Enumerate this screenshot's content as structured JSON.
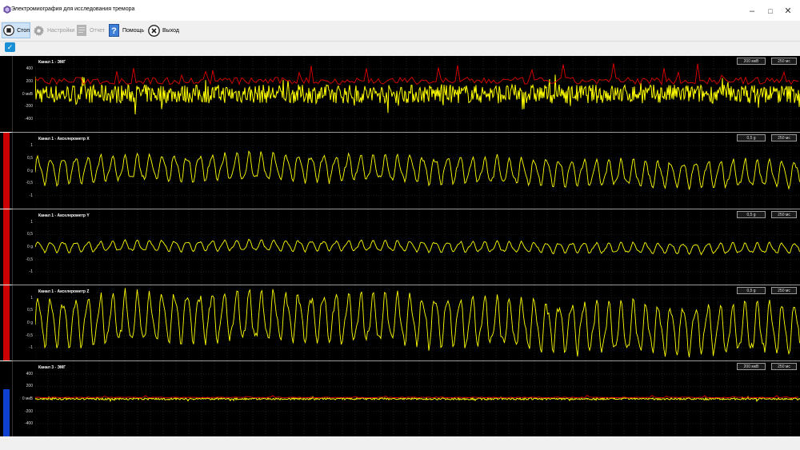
{
  "window": {
    "title": "Электромиография для исследования тремора",
    "controls": [
      "–",
      "□",
      "✕"
    ]
  },
  "toolbar": {
    "stop_label": "Стоп",
    "settings_label": "Настройки",
    "report_label": "Отчет",
    "help_label": "Помощь",
    "exit_label": "Выход"
  },
  "channels": [
    {
      "title": "Канал 1 - ЭМГ",
      "scale": "200 мкВ",
      "time": "250 мс",
      "kind": "emg",
      "ticks": [
        "400",
        "200",
        "0 мкВ",
        "-200",
        "-400"
      ],
      "level": 0.0,
      "level_color": "#cc0000",
      "amplitude": 0.55,
      "env_color": "#e00000"
    },
    {
      "title": "Канал 1 - Акселерометр X",
      "scale": "0,5 g",
      "time": "250 мс",
      "kind": "accel",
      "ticks": [
        "1",
        "0,5",
        "0 g",
        "-0,5",
        "-1"
      ],
      "level": 1.0,
      "level_color": "#cc0000",
      "amplitude": 0.45
    },
    {
      "title": "Канал 1 - Акселерометр Y",
      "scale": "0,5 g",
      "time": "250 мс",
      "kind": "accel",
      "ticks": [
        "1",
        "0,5",
        "0 g",
        "-0,5",
        "-1"
      ],
      "level": 1.0,
      "level_color": "#cc0000",
      "amplitude": 0.18
    },
    {
      "title": "Канал 1 - Акселерометр Z",
      "scale": "0,5 g",
      "time": "250 мс",
      "kind": "accel",
      "ticks": [
        "1",
        "0,5",
        "0 g",
        "-0,5",
        "-1"
      ],
      "level": 1.0,
      "level_color": "#cc0000",
      "amplitude": 0.85
    },
    {
      "title": "Канал 3 - ЭМГ",
      "scale": "200 мкВ",
      "time": "250 мс",
      "kind": "emg",
      "ticks": [
        "400",
        "200",
        "0 мкВ",
        "-200",
        "-400"
      ],
      "level": 0.63,
      "level_color": "#1040d0",
      "amplitude": 0.06,
      "env_color": "#e00000"
    }
  ],
  "colors": {
    "signal": "#ffff00",
    "envelope": "#e00000",
    "grid": "#3a3a3a",
    "accent": "#1a8fd6"
  }
}
